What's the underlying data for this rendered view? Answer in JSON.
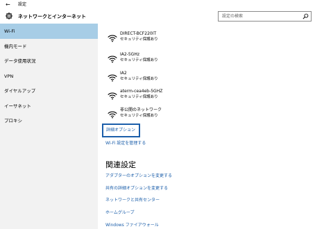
{
  "titlebar": {
    "back": "←",
    "title": "設定"
  },
  "header": {
    "title": "ネットワークとインターネット",
    "search_placeholder": "設定の検索"
  },
  "sidebar": {
    "items": [
      {
        "label": "Wi-Fi",
        "active": true
      },
      {
        "label": "機内モード"
      },
      {
        "label": "データ使用状況"
      },
      {
        "label": "VPN"
      },
      {
        "label": "ダイヤルアップ"
      },
      {
        "label": "イーサネット"
      },
      {
        "label": "プロキシ"
      }
    ]
  },
  "networks": [
    {
      "name": "DIRECT-BCF220IT",
      "security": "セキュリティ保護あり"
    },
    {
      "name": "IA2-5GHz",
      "security": "セキュリティ保護あり"
    },
    {
      "name": "IA2",
      "security": "セキュリティ保護あり"
    },
    {
      "name": "aterm-cea4eb-5GHZ",
      "security": "セキュリティ保護あり"
    },
    {
      "name": "非公開のネットワーク",
      "security": "セキュリティ保護あり"
    }
  ],
  "advanced_options": "詳細オプション",
  "manage_wifi": "Wi-Fi 設定を管理する",
  "related": {
    "title": "関連設定",
    "links": [
      "アダプターのオプションを変更する",
      "共有の詳細オプションを変更する",
      "ネットワークと共有センター",
      "ホームグループ",
      "Windows ファイアウォール"
    ]
  },
  "colors": {
    "accent": "#1b5eaa",
    "sidebar_bg": "#f2f2f2",
    "selected": "#a7cde6"
  }
}
